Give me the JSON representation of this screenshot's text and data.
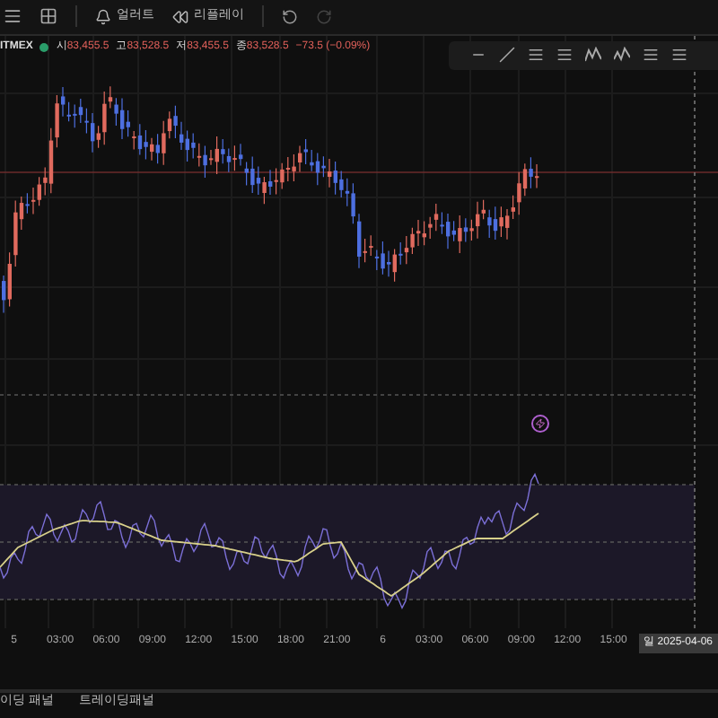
{
  "toolbar": {
    "alert_label": "얼러트",
    "replay_label": "리플레이"
  },
  "legend": {
    "exchange": "ITMEX",
    "values": [
      {
        "label": "시",
        "value": "83,455.5"
      },
      {
        "label": "고",
        "value": "83,528.5"
      },
      {
        "label": "저",
        "value": "83,455.5"
      },
      {
        "label": "종",
        "value": "83,528.5"
      }
    ],
    "change": "−73.5 (−0.09%)"
  },
  "time_axis": {
    "labels": [
      "5",
      "03:00",
      "06:00",
      "09:00",
      "12:00",
      "15:00",
      "18:00",
      "21:00",
      "6",
      "03:00",
      "06:00",
      "09:00",
      "12:00",
      "15:00"
    ],
    "current_date": "일 2025-04-06"
  },
  "bottom_tabs": [
    {
      "label": "이딩 패널",
      "selected": false
    },
    {
      "label": "트레이딩패널",
      "selected": false
    }
  ]
}
